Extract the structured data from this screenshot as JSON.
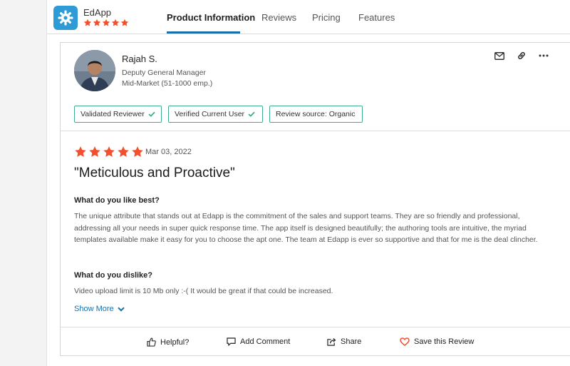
{
  "app": {
    "name": "EdApp",
    "rating_stars": 5,
    "brand_color": "#2e9bd6",
    "star_color": "#f34f2c"
  },
  "tabs": [
    {
      "label": "Product Information",
      "active": true
    },
    {
      "label": "Reviews",
      "active": false
    },
    {
      "label": "Pricing",
      "active": false
    },
    {
      "label": "Features",
      "active": false
    }
  ],
  "review": {
    "reviewer": {
      "name": "Rajah S.",
      "title": "Deputy General Manager",
      "segment": "Mid-Market (51-1000 emp.)"
    },
    "actions": [
      "mail-icon",
      "link-icon",
      "more-icon"
    ],
    "badges": [
      {
        "label": "Validated Reviewer",
        "check": true
      },
      {
        "label": "Verified Current User",
        "check": true
      },
      {
        "label": "Review source: Organic",
        "check": false
      }
    ],
    "badge_border_color": "#3fae8c",
    "rating_stars": 5,
    "date": "Mar 03, 2022",
    "title": "\"Meticulous and Proactive\"",
    "like_label": "What do you like best?",
    "like_text": "The unique attribute that stands out at Edapp is the commitment of the sales and support teams. They are so friendly and professional, addressing all your needs in super quick response time. The app itself is designed beautifully; the authoring tools are intuitive, the myriad templates available make it easy for you to choose the apt one. The team at Edapp is ever so supportive and that for me is the deal clincher.",
    "dislike_label": "What do you dislike?",
    "dislike_text": "Video upload limit is 10 Mb only :-( It would be great if that could be increased.",
    "show_more": "Show More",
    "link_color": "#1b6fa8"
  },
  "footer": {
    "helpful": "Helpful?",
    "comment": "Add Comment",
    "share": "Share",
    "save": "Save this Review"
  }
}
